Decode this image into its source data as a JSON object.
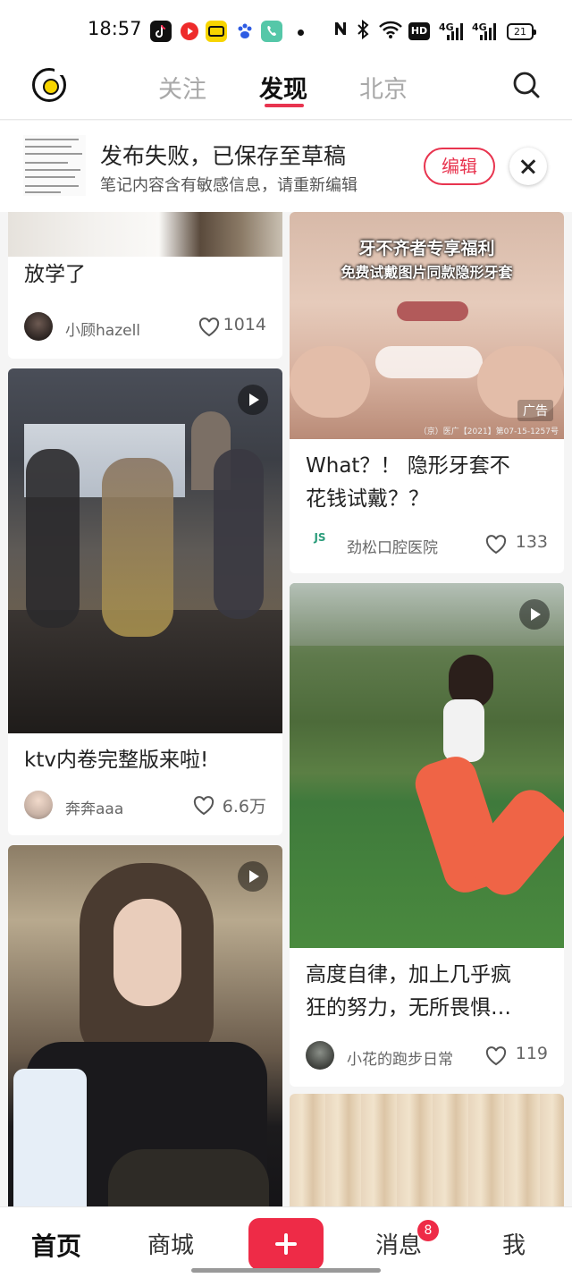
{
  "status_bar": {
    "time": "18:57",
    "network_hd": "HD",
    "network_1": "4G",
    "network_2": "4G",
    "battery": "21",
    "icons": [
      "tiktok-icon",
      "red-app-icon",
      "yellow-app-icon",
      "baidu-paw-icon",
      "phone-icon",
      "nfc-icon",
      "bluetooth-icon",
      "wifi-icon"
    ]
  },
  "top_nav": {
    "tabs": [
      {
        "label": "关注",
        "active": false
      },
      {
        "label": "发现",
        "active": true
      },
      {
        "label": "北京",
        "active": false
      }
    ],
    "accent_color": "#e8344f"
  },
  "draft_banner": {
    "title": "发布失败，已保存至草稿",
    "subtitle": "笔记内容含有敏感信息，请重新编辑",
    "edit_label": "编辑"
  },
  "feed": {
    "left_column": [
      {
        "title": "放学了",
        "author": "小顾hazell",
        "likes": "1014",
        "video": false
      },
      {
        "title": "ktv内卷完整版来啦!",
        "author": "奔奔aaa",
        "likes": "6.6万",
        "video": true
      },
      {
        "title": "",
        "author": "",
        "likes": "",
        "video": true
      }
    ],
    "right_column": [
      {
        "title": "What？！ 隐形牙套不花钱试戴？？",
        "title_line1": "What？！ 隐形牙套不",
        "title_line2": "花钱试戴？？",
        "author": "劲松口腔医院",
        "likes": "133",
        "ad": true,
        "ad_label": "广告",
        "overlay_line1": "牙不齐者专享福利",
        "overlay_line2": "免费试戴图片同款隐形牙套",
        "license": "（京）医广【2021】第07-15-1257号",
        "brand_logo": "JS"
      },
      {
        "title_line1": "高度自律，加上几乎疯",
        "title_line2": "狂的努力，无所畏惧…",
        "author": "小花的跑步日常",
        "likes": "119",
        "video": true
      },
      {
        "title": "",
        "author": "",
        "likes": "",
        "video": false
      }
    ]
  },
  "bottom_nav": {
    "items": [
      {
        "label": "首页",
        "active": true
      },
      {
        "label": "商城",
        "active": false
      },
      {
        "label": "消息",
        "active": false,
        "badge": "8"
      },
      {
        "label": "我",
        "active": false
      }
    ],
    "plus_color": "#ee2b47"
  }
}
